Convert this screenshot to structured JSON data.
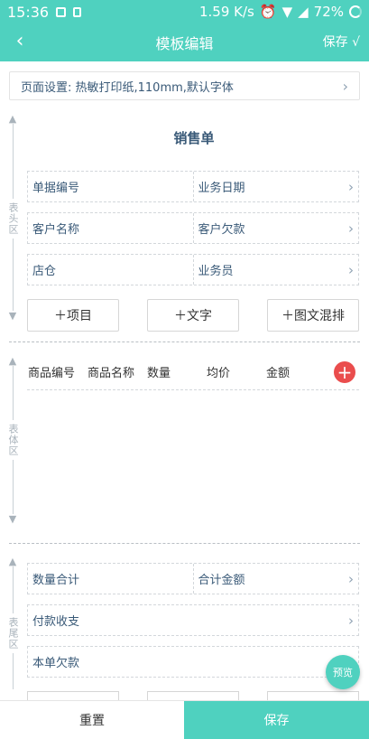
{
  "status_bar": {
    "time": "15:36",
    "network_speed": "1.59 K/s",
    "battery": "72%",
    "icons": [
      "image-icon",
      "sim-icon",
      "alarm-icon",
      "wifi-icon",
      "signal-icon",
      "battery-ring-icon"
    ]
  },
  "header": {
    "title": "模板编辑",
    "save_label": "保存 √",
    "back_icon": "chevron-left-icon"
  },
  "page_settings": {
    "text": "页面设置: 热敏打印纸,110mm,默认字体"
  },
  "sections": {
    "header_section": "表头区",
    "body_section": "表体区",
    "footer_section": "表尾区"
  },
  "receipt": {
    "title": "销售单"
  },
  "header_fields": [
    {
      "left": "单据编号",
      "right": "业务日期"
    },
    {
      "left": "客户名称",
      "right": "客户欠款"
    },
    {
      "left": "店仓",
      "right": "业务员"
    }
  ],
  "add_buttons": {
    "item": "＋项目",
    "text": "＋文字",
    "mixed": "＋图文混排"
  },
  "table_columns": [
    "商品编号",
    "商品名称",
    "数量",
    "均价",
    "金额"
  ],
  "footer_fields": [
    {
      "left": "数量合计",
      "right": "合计金额"
    },
    {
      "left": "付款收支",
      "right": ""
    },
    {
      "left": "本单欠款",
      "right": ""
    }
  ],
  "preview_label": "预览",
  "bottom_bar": {
    "reset_label": "重置",
    "save_label": "保存"
  },
  "colors": {
    "accent": "#4fd1bf",
    "danger": "#ea4d4d",
    "text": "#3a5a78"
  }
}
